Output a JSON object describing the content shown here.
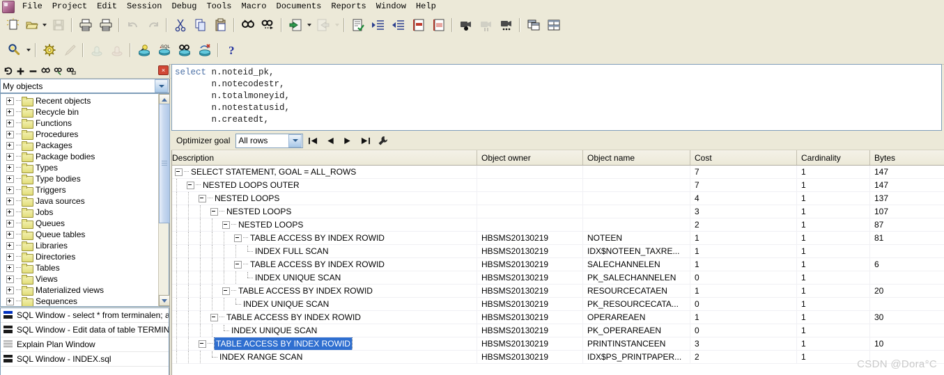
{
  "app": {
    "icon": "plsql-developer-icon",
    "watermark": "CSDN @Dora°C"
  },
  "menubar": {
    "items": [
      {
        "label": "File"
      },
      {
        "label": "Project"
      },
      {
        "label": "Edit"
      },
      {
        "label": "Session"
      },
      {
        "label": "Debug"
      },
      {
        "label": "Tools"
      },
      {
        "label": "Macro"
      },
      {
        "label": "Documents"
      },
      {
        "label": "Reports"
      },
      {
        "label": "Window"
      },
      {
        "label": "Help"
      }
    ]
  },
  "toolbar_main": {
    "buttons": [
      {
        "name": "new-icon",
        "title": "New"
      },
      {
        "name": "open-icon",
        "title": "Open"
      },
      {
        "name": "open-dropdown-icon",
        "title": "Open list"
      },
      {
        "name": "save-icon",
        "title": "Save"
      },
      {
        "name": "print-icon",
        "title": "Print"
      },
      {
        "name": "print-preview-icon",
        "title": "Print preview"
      },
      {
        "name": "undo-icon",
        "title": "Undo"
      },
      {
        "name": "redo-icon",
        "title": "Redo"
      },
      {
        "name": "cut-icon",
        "title": "Cut"
      },
      {
        "name": "copy-icon",
        "title": "Copy"
      },
      {
        "name": "paste-icon",
        "title": "Paste"
      },
      {
        "name": "find-icon",
        "title": "Find"
      },
      {
        "name": "find-next-icon",
        "title": "Find next"
      },
      {
        "name": "previous-document-icon",
        "title": "Previous"
      },
      {
        "name": "previous-dropdown-icon",
        "title": "Previous list"
      },
      {
        "name": "next-document-icon",
        "title": "Next"
      },
      {
        "name": "next-dropdown-icon",
        "title": "Next list"
      },
      {
        "name": "check-syntax-icon",
        "title": "Check"
      },
      {
        "name": "indent-icon",
        "title": "Indent"
      },
      {
        "name": "outdent-icon",
        "title": "Outdent"
      },
      {
        "name": "comment-icon",
        "title": "Comment"
      },
      {
        "name": "uncomment-icon",
        "title": "Uncomment"
      },
      {
        "name": "record-macro-icon",
        "title": "Record macro"
      },
      {
        "name": "pause-macro-icon",
        "title": "Pause macro"
      },
      {
        "name": "play-macro-icon",
        "title": "Play macro"
      },
      {
        "name": "cascade-windows-icon",
        "title": "Cascade"
      },
      {
        "name": "tile-windows-icon",
        "title": "Tile"
      }
    ]
  },
  "toolbar_session": {
    "buttons": [
      {
        "name": "explain-plan-icon",
        "title": "Explain plan"
      },
      {
        "name": "explain-plan-dropdown-icon",
        "title": "Explain plan list"
      },
      {
        "name": "settings-icon",
        "title": "Preferences"
      },
      {
        "name": "beautifier-icon",
        "title": "Beautifier"
      },
      {
        "name": "commit-icon",
        "title": "Commit"
      },
      {
        "name": "rollback-icon",
        "title": "Rollback"
      },
      {
        "name": "execute-icon",
        "title": "Execute"
      },
      {
        "name": "sql-icon",
        "title": "SQL"
      },
      {
        "name": "break-icon",
        "title": "Break"
      },
      {
        "name": "kill-session-icon",
        "title": "Kill session"
      },
      {
        "name": "help-icon",
        "title": "Help"
      }
    ]
  },
  "sidebar": {
    "toolbar": [
      {
        "name": "refresh-icon",
        "label": "↻"
      },
      {
        "name": "add-icon",
        "label": "+"
      },
      {
        "name": "remove-icon",
        "label": "−"
      },
      {
        "name": "find-icon",
        "label": "find"
      },
      {
        "name": "filter-icon",
        "label": "filter"
      },
      {
        "name": "lock-filter-icon",
        "label": "lock"
      }
    ],
    "close_label": "×",
    "browser_filter": "My objects",
    "tree_items": [
      {
        "label": "Recent objects"
      },
      {
        "label": "Recycle bin"
      },
      {
        "label": "Functions"
      },
      {
        "label": "Procedures"
      },
      {
        "label": "Packages"
      },
      {
        "label": "Package bodies"
      },
      {
        "label": "Types"
      },
      {
        "label": "Type bodies"
      },
      {
        "label": "Triggers"
      },
      {
        "label": "Java sources"
      },
      {
        "label": "Jobs"
      },
      {
        "label": "Queues"
      },
      {
        "label": "Queue tables"
      },
      {
        "label": "Libraries"
      },
      {
        "label": "Directories"
      },
      {
        "label": "Tables"
      },
      {
        "label": "Views"
      },
      {
        "label": "Materialized views"
      },
      {
        "label": "Sequences"
      }
    ],
    "window_list": [
      {
        "icon": "sql-window-icon",
        "label": "SQL Window - select * from terminalen; alter tabl"
      },
      {
        "icon": "sql-window-icon",
        "label": "SQL Window - Edit data of table TERMINALEN("
      },
      {
        "icon": "explain-plan-window-icon",
        "label": "Explain Plan Window"
      },
      {
        "icon": "sql-window-icon",
        "label": "SQL Window - INDEX.sql"
      }
    ]
  },
  "editor": {
    "lines": [
      {
        "keyword": "select",
        "rest": " n.noteid_pk,"
      },
      {
        "keyword": "",
        "rest": "       n.notecodestr,"
      },
      {
        "keyword": "",
        "rest": "       n.totalmoneyid,"
      },
      {
        "keyword": "",
        "rest": "       n.notestatusid,"
      },
      {
        "keyword": "",
        "rest": "       n.createdt,"
      }
    ]
  },
  "optimizer_bar": {
    "label": "Optimizer goal",
    "goal_value": "All rows",
    "nav": [
      {
        "name": "first-record-button",
        "glyph": "first"
      },
      {
        "name": "previous-record-button",
        "glyph": "prev"
      },
      {
        "name": "next-record-button",
        "glyph": "next"
      },
      {
        "name": "last-record-button",
        "glyph": "last"
      },
      {
        "name": "plan-settings-button",
        "glyph": "wrench"
      }
    ]
  },
  "plan_grid": {
    "columns": [
      "Description",
      "Object owner",
      "Object name",
      "Cost",
      "Cardinality",
      "Bytes"
    ],
    "rows": [
      {
        "indent": 0,
        "node": "expand",
        "description": "SELECT STATEMENT, GOAL = ALL_ROWS",
        "owner": "",
        "object": "",
        "cost": "7",
        "cardinality": "1",
        "bytes": "147",
        "selected": false
      },
      {
        "indent": 1,
        "node": "expand",
        "description": "NESTED LOOPS OUTER",
        "owner": "",
        "object": "",
        "cost": "7",
        "cardinality": "1",
        "bytes": "147",
        "selected": false
      },
      {
        "indent": 2,
        "node": "expand",
        "description": "NESTED LOOPS",
        "owner": "",
        "object": "",
        "cost": "4",
        "cardinality": "1",
        "bytes": "137",
        "selected": false
      },
      {
        "indent": 3,
        "node": "expand",
        "description": "NESTED LOOPS",
        "owner": "",
        "object": "",
        "cost": "3",
        "cardinality": "1",
        "bytes": "107",
        "selected": false
      },
      {
        "indent": 4,
        "node": "expand",
        "description": "NESTED LOOPS",
        "owner": "",
        "object": "",
        "cost": "2",
        "cardinality": "1",
        "bytes": "87",
        "selected": false
      },
      {
        "indent": 5,
        "node": "expand",
        "description": "TABLE ACCESS BY INDEX ROWID",
        "owner": "HBSMS20130219",
        "object": "NOTEEN",
        "cost": "1",
        "cardinality": "1",
        "bytes": "81",
        "selected": false
      },
      {
        "indent": 6,
        "node": "leaf",
        "description": "INDEX FULL SCAN",
        "owner": "HBSMS20130219",
        "object": "IDX$NOTEEN_TAXRE...",
        "cost": "1",
        "cardinality": "1",
        "bytes": "",
        "selected": false
      },
      {
        "indent": 5,
        "node": "expand",
        "description": "TABLE ACCESS BY INDEX ROWID",
        "owner": "HBSMS20130219",
        "object": "SALECHANNELEN",
        "cost": "1",
        "cardinality": "1",
        "bytes": "6",
        "selected": false
      },
      {
        "indent": 6,
        "node": "leaf",
        "description": "INDEX UNIQUE SCAN",
        "owner": "HBSMS20130219",
        "object": "PK_SALECHANNELEN",
        "cost": "0",
        "cardinality": "1",
        "bytes": "",
        "selected": false
      },
      {
        "indent": 4,
        "node": "expand",
        "description": "TABLE ACCESS BY INDEX ROWID",
        "owner": "HBSMS20130219",
        "object": "RESOURCECATAEN",
        "cost": "1",
        "cardinality": "1",
        "bytes": "20",
        "selected": false
      },
      {
        "indent": 5,
        "node": "leaf",
        "description": "INDEX UNIQUE SCAN",
        "owner": "HBSMS20130219",
        "object": "PK_RESOURCECATA...",
        "cost": "0",
        "cardinality": "1",
        "bytes": "",
        "selected": false
      },
      {
        "indent": 3,
        "node": "expand",
        "description": "TABLE ACCESS BY INDEX ROWID",
        "owner": "HBSMS20130219",
        "object": "OPERAREAEN",
        "cost": "1",
        "cardinality": "1",
        "bytes": "30",
        "selected": false
      },
      {
        "indent": 4,
        "node": "leaf",
        "description": "INDEX UNIQUE SCAN",
        "owner": "HBSMS20130219",
        "object": "PK_OPERAREAEN",
        "cost": "0",
        "cardinality": "1",
        "bytes": "",
        "selected": false
      },
      {
        "indent": 2,
        "node": "expand",
        "description": "TABLE ACCESS BY INDEX ROWID",
        "owner": "HBSMS20130219",
        "object": "PRINTINSTANCEEN",
        "cost": "3",
        "cardinality": "1",
        "bytes": "10",
        "selected": true
      },
      {
        "indent": 3,
        "node": "leaf",
        "description": "INDEX RANGE SCAN",
        "owner": "HBSMS20130219",
        "object": "IDX$PS_PRINTPAPER...",
        "cost": "2",
        "cardinality": "1",
        "bytes": "",
        "selected": false
      }
    ]
  },
  "colors": {
    "window_bg": "#ece9d8",
    "selection": "#2f6fd0",
    "keyword": "#4a6fa5",
    "folder": "#e2dd7a",
    "grid_bg": "#ffffff"
  }
}
